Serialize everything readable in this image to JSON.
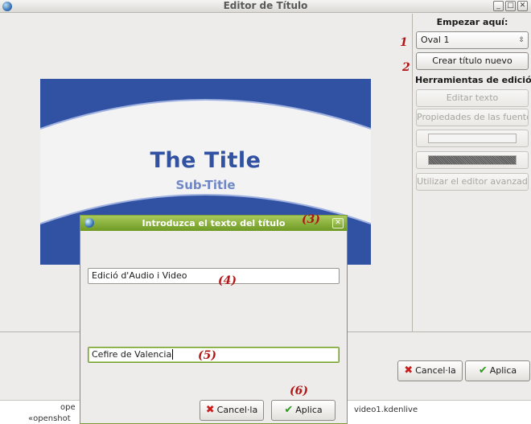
{
  "window": {
    "title": "Editor de Título"
  },
  "sidebar": {
    "start_heading": "Empezar aquí:",
    "template_selected": "Oval 1",
    "new_title_button": "Crear título nuevo",
    "tools_heading": "Herramientas de edició",
    "edit_text_button": "Editar texto",
    "font_props_button": "Propiedades de las fuente",
    "advanced_editor_button": "Utilizar el editor avanzad"
  },
  "preview": {
    "title": "The Title",
    "subtitle": "Sub-Title",
    "colors": {
      "band": "#3152a3",
      "title": "#3152a3",
      "subtitle": "#6f86c7"
    }
  },
  "main_buttons": {
    "cancel": "Cancel·la",
    "apply": "Aplica"
  },
  "background_strip": {
    "left_text_1": "ope",
    "left_text_2": "«openshot",
    "right_text": "video1.kdenlive"
  },
  "dialog": {
    "title": "Introduzca el texto del título",
    "line1_value": "Edició d'Audio i Video",
    "line2_value": "Cefire de Valencia",
    "cancel": "Cancel·la",
    "apply": "Aplica"
  },
  "annotations": {
    "a1": "1",
    "a2": "2",
    "a3": "(3)",
    "a4": "(4)",
    "a5": "(5)",
    "a6": "(6)"
  }
}
